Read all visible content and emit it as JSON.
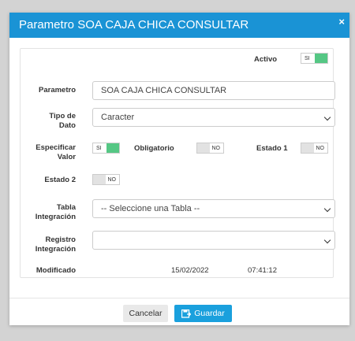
{
  "dialog": {
    "title": "Parametro SOA CAJA CHICA CONSULTAR",
    "close": "×"
  },
  "form": {
    "activo": {
      "label": "Activo",
      "state": "SI"
    },
    "parametro": {
      "label": "Parametro",
      "value": "SOA CAJA CHICA CONSULTAR"
    },
    "tipo_dato": {
      "label1": "Tipo de",
      "label2": "Dato",
      "value": "Caracter"
    },
    "especificar_valor": {
      "label1": "Especificar",
      "label2": "Valor",
      "state": "SI"
    },
    "obligatorio": {
      "label": "Obligatorio",
      "state": "NO"
    },
    "estado1": {
      "label": "Estado 1",
      "state": "NO"
    },
    "estado2": {
      "label": "Estado 2",
      "state": "NO"
    },
    "tabla_integracion": {
      "label1": "Tabla",
      "label2": "Integración",
      "value": "-- Seleccione una Tabla --"
    },
    "registro_integracion": {
      "label1": "Registro",
      "label2": "Integración",
      "value": ""
    },
    "modificado": {
      "label": "Modificado",
      "date": "15/02/2022",
      "time": "07:41:12"
    }
  },
  "footer": {
    "cancel": "Cancelar",
    "save": "Guardar"
  },
  "colors": {
    "header": "#1a93d5",
    "toggle_on": "#55c784",
    "save_button": "#1aa0dd"
  },
  "icons": {
    "close": "close-icon",
    "dropdown": "chevron-down-icon",
    "save": "save-icon"
  }
}
